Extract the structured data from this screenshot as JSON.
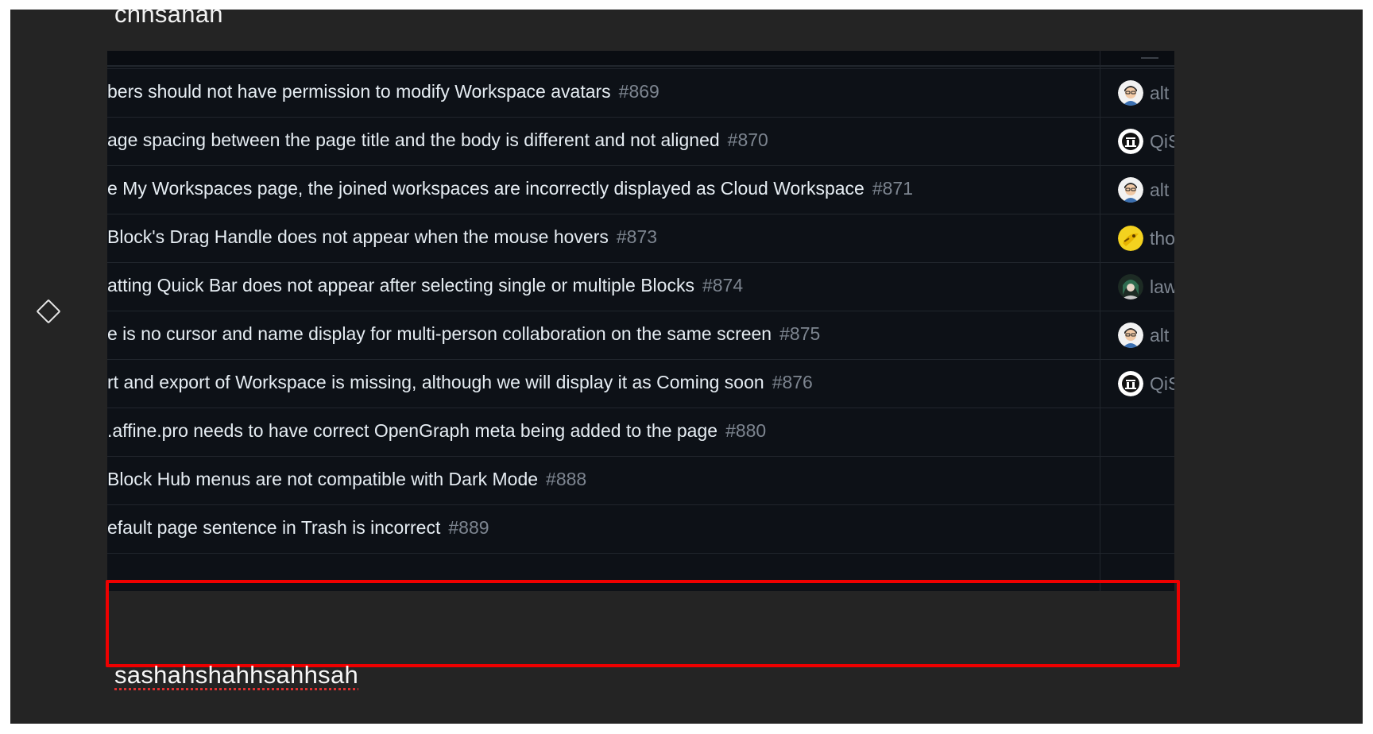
{
  "editor": {
    "top_text": "chhsahah",
    "bottom_text": "sashahshahhsahhsah"
  },
  "issues": [
    {
      "title": "bers should not have permission to modify Workspace avatars",
      "number": "#869",
      "assignee": "alt",
      "avatar": "avatar-glasses-man"
    },
    {
      "title": "age spacing between the page title and the body is different and not aligned",
      "number": "#870",
      "assignee": "QiS",
      "avatar": "avatar-logo-badge"
    },
    {
      "title": "e My Workspaces page, the joined workspaces are incorrectly displayed as Cloud Workspace",
      "number": "#871",
      "assignee": "alt",
      "avatar": "avatar-glasses-man"
    },
    {
      "title": " Block's Drag Handle does not appear when the mouse hovers",
      "number": "#873",
      "assignee": "tho",
      "avatar": "avatar-yellow-cartoon"
    },
    {
      "title": "atting Quick Bar does not appear after selecting single or multiple Blocks",
      "number": "#874",
      "assignee": "law",
      "avatar": "avatar-anime-character"
    },
    {
      "title": "e is no cursor and name display for multi-person collaboration on the same screen",
      "number": "#875",
      "assignee": "alt",
      "avatar": "avatar-glasses-man"
    },
    {
      "title": "rt and export of Workspace is missing, although we will display it as Coming soon",
      "number": "#876",
      "assignee": "QiS",
      "avatar": "avatar-logo-badge"
    },
    {
      "title": ".affine.pro needs to have correct OpenGraph meta being added to the page",
      "number": "#880",
      "assignee": "",
      "avatar": ""
    },
    {
      "title": " Block Hub menus are not compatible with Dark Mode",
      "number": "#888",
      "assignee": "",
      "avatar": ""
    },
    {
      "title": "efault page sentence in Trash is incorrect",
      "number": "#889",
      "assignee": "",
      "avatar": ""
    }
  ],
  "colors": {
    "highlight_border": "#ee0000",
    "canvas_bg": "#242424",
    "embed_bg": "#0d1117"
  }
}
